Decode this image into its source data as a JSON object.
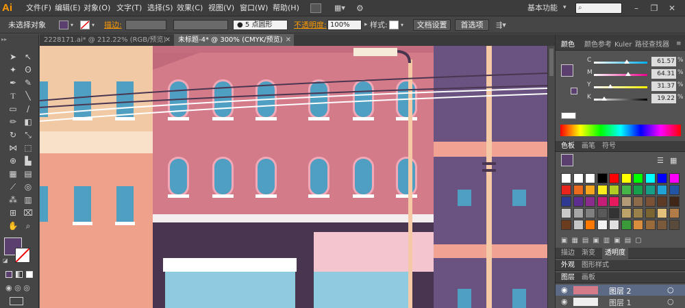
{
  "app": {
    "logo": "Ai",
    "workspace": "基本功能"
  },
  "menu": [
    "文件(F)",
    "编辑(E)",
    "对象(O)",
    "文字(T)",
    "选择(S)",
    "效果(C)",
    "视图(V)",
    "窗口(W)",
    "帮助(H)"
  ],
  "control": {
    "selection": "未选择对象",
    "stroke_label": "描边:",
    "brush": "5 点圆形",
    "opacity_label": "不透明度:",
    "opacity_value": "100%",
    "style_label": "样式:",
    "doc_setup": "文档设置",
    "prefs": "首选项"
  },
  "tabs": [
    {
      "label": "2228171.ai* @ 212.22% (RGB/预览)",
      "active": false
    },
    {
      "label": "未标题-4* @ 300% (CMYK/预览)",
      "active": true
    }
  ],
  "color_panel": {
    "tabs": [
      "颜色",
      "颜色参考",
      "Kuler",
      "路径查找器"
    ],
    "sliders": [
      {
        "name": "C",
        "value": "61.57",
        "unit": "%",
        "fill": 0.6157
      },
      {
        "name": "M",
        "value": "64.31",
        "unit": "%",
        "fill": 0.6431
      },
      {
        "name": "Y",
        "value": "31.37",
        "unit": "%",
        "fill": 0.3137
      },
      {
        "name": "K",
        "value": "19.22",
        "unit": "%",
        "fill": 0.1922
      }
    ]
  },
  "swatch_panel": {
    "tabs": [
      "色板",
      "画笔",
      "符号"
    ]
  },
  "stroke_panel": {
    "tabs": [
      "描边",
      "渐变",
      "透明度"
    ]
  },
  "appearance_panel": {
    "tabs": [
      "外观",
      "图形样式"
    ]
  },
  "layers_panel": {
    "tabs": [
      "图层",
      "画板"
    ],
    "layers": [
      "图层 2",
      "图层 1"
    ]
  },
  "colors": {
    "fill": "#5b3f6e",
    "accent_orange": "#ff9a00"
  }
}
